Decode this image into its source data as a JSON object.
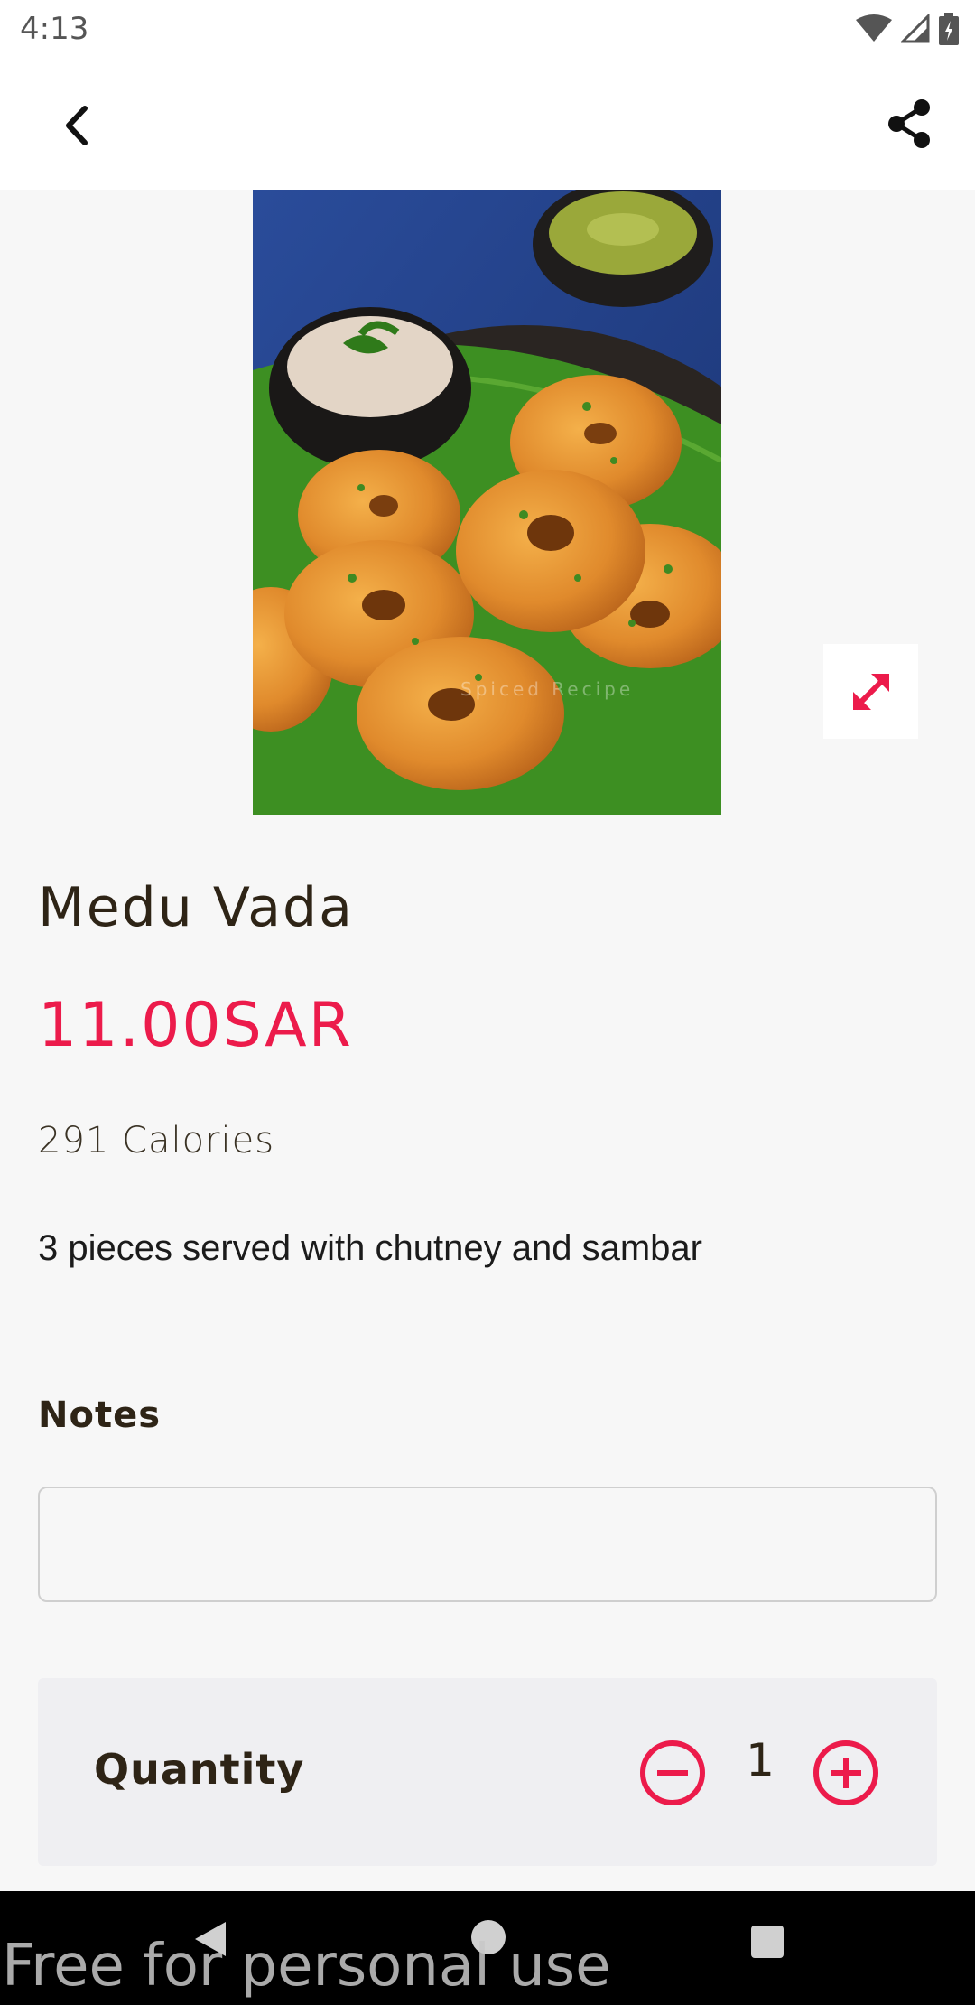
{
  "status_bar": {
    "time": "4:13",
    "icons": [
      "wifi-icon",
      "signal-icon",
      "battery-icon"
    ]
  },
  "app_bar": {
    "back_icon": "chevron-left-icon",
    "share_icon": "share-icon"
  },
  "item": {
    "name": "Medu Vada",
    "price": "11.00SAR",
    "calories": "291 Calories",
    "description": "3 pieces served with chutney and sambar",
    "image_watermark": "Spiced Recipe"
  },
  "notes": {
    "label": "Notes",
    "value": "",
    "placeholder": ""
  },
  "quantity": {
    "label": "Quantity",
    "value": "1"
  },
  "watermark": "Free for personal use",
  "colors": {
    "accent": "#ec1b4b",
    "text_dark": "#2e2416",
    "background": "#f7f7f7",
    "card": "#efeff2"
  }
}
